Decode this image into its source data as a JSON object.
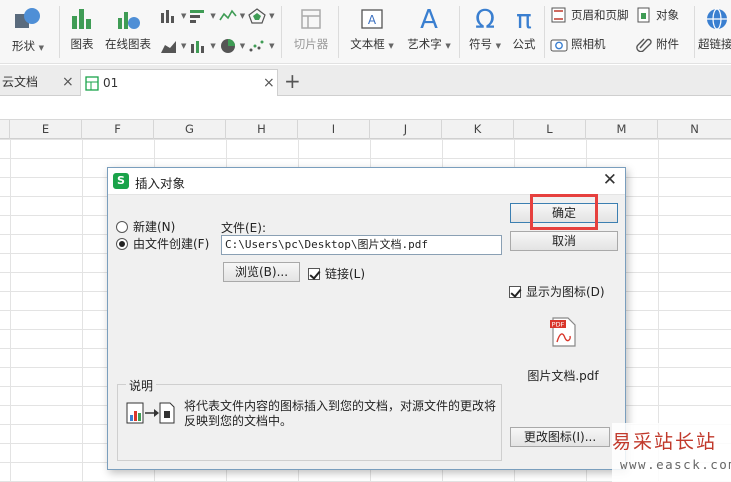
{
  "ribbon": {
    "shape_label": "形状",
    "chart_label": "图表",
    "online_chart_label": "在线图表",
    "slicer_label": "切片器",
    "textbox_label": "文本框",
    "wordart_label": "艺术字",
    "symbol_label": "符号",
    "formula_label": "公式",
    "header_footer_label": "页眉和页脚",
    "object_label": "对象",
    "photo_label": "照相机",
    "attachment_label": "附件",
    "hyperlink_label": "超链接"
  },
  "tabs": [
    {
      "label": "云文档"
    },
    {
      "label": "01"
    }
  ],
  "grid": {
    "columns": [
      "E",
      "F",
      "G",
      "H",
      "I",
      "J",
      "K",
      "L",
      "M",
      "N"
    ]
  },
  "dialog": {
    "title": "插入对象",
    "radio_new": "新建(N)",
    "radio_from_file": "由文件创建(F)",
    "file_label": "文件(E):",
    "file_path": "C:\\Users\\pc\\Desktop\\图片文档.pdf",
    "browse_button": "浏览(B)...",
    "link_checkbox": "链接(L)",
    "ok_button": "确定",
    "cancel_button": "取消",
    "display_as_icon": "显示为图标(D)",
    "icon_caption": "图片文档.pdf",
    "change_icon_button": "更改图标(I)...",
    "result_title": "说明",
    "result_text": "将代表文件内容的图标插入到您的文档，对源文件的更改将反映到您的文档中。",
    "pdf_badge": "PDF"
  },
  "watermark": {
    "line1": "易采站长站",
    "line2": "www.easck.com"
  },
  "colors": {
    "accent_green": "#1aa34a",
    "highlight_red": "#e6403e",
    "dialog_border": "#7a9ebd"
  }
}
